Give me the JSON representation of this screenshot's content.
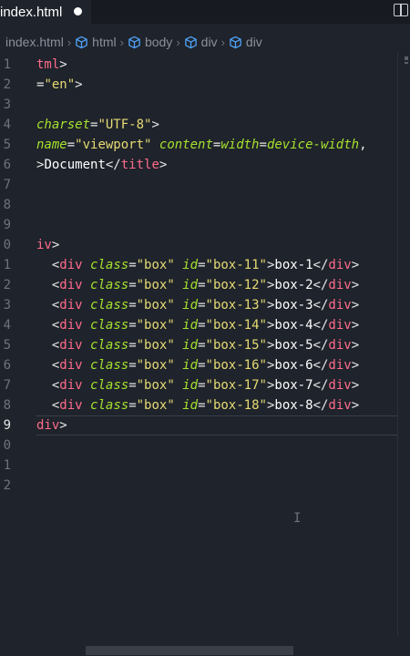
{
  "tab": {
    "title": "index.html"
  },
  "breadcrumb": [
    {
      "label": "index.html",
      "has_icon": false
    },
    {
      "label": "html",
      "has_icon": true
    },
    {
      "label": "body",
      "has_icon": true
    },
    {
      "label": "div",
      "has_icon": true
    },
    {
      "label": "div",
      "has_icon": true
    }
  ],
  "editor": {
    "active_line": "9",
    "lines": [
      {
        "num": "1",
        "text": "tml>"
      },
      {
        "num": "2",
        "text": "=\"en\">"
      },
      {
        "num": "3",
        "text": ""
      },
      {
        "num": "4",
        "text": "charset=\"UTF-8\">"
      },
      {
        "num": "5",
        "text": "name=\"viewport\" content=\"width=device-width,"
      },
      {
        "num": "6",
        "text": ">Document</title>"
      },
      {
        "num": "7",
        "text": ""
      },
      {
        "num": "8",
        "text": ""
      },
      {
        "num": "9",
        "text": ""
      },
      {
        "num": "0",
        "text": "iv>"
      },
      {
        "num": "1",
        "text": "  <div class=\"box\" id=\"box-11\">box-1</div>"
      },
      {
        "num": "2",
        "text": "  <div class=\"box\" id=\"box-12\">box-2</div>"
      },
      {
        "num": "3",
        "text": "  <div class=\"box\" id=\"box-13\">box-3</div>"
      },
      {
        "num": "4",
        "text": "  <div class=\"box\" id=\"box-14\">box-4</div>"
      },
      {
        "num": "5",
        "text": "  <div class=\"box\" id=\"box-15\">box-5</div>"
      },
      {
        "num": "6",
        "text": "  <div class=\"box\" id=\"box-16\">box-6</div>"
      },
      {
        "num": "7",
        "text": "  <div class=\"box\" id=\"box-17\">box-7</div>"
      },
      {
        "num": "8",
        "text": "  <div class=\"box\" id=\"box-18\">box-8</div>"
      },
      {
        "num": "9",
        "text": "div>"
      },
      {
        "num": "0",
        "text": ""
      },
      {
        "num": "1",
        "text": ""
      },
      {
        "num": "2",
        "text": ""
      }
    ]
  },
  "colors": {
    "background": "#1f232b",
    "tag": "#ff6b8b",
    "attribute": "#a6e22e",
    "string": "#e6db74",
    "line_number": "#6d737e"
  }
}
